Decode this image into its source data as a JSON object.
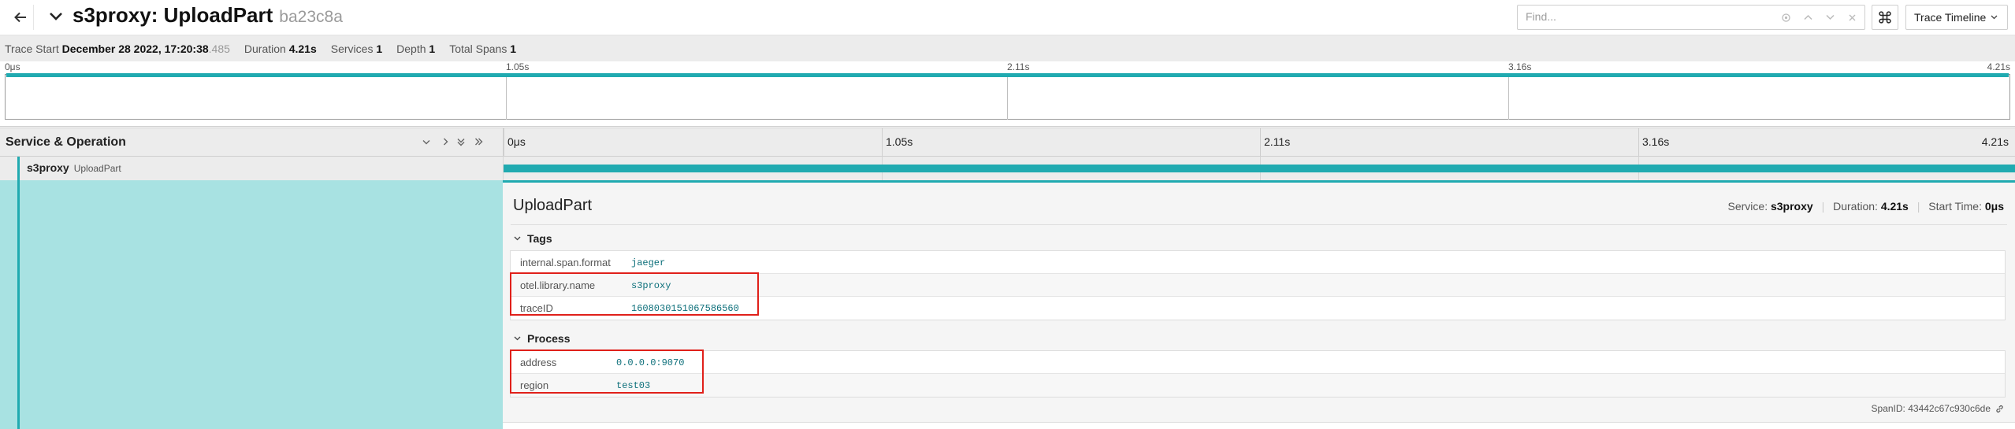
{
  "header": {
    "title": "s3proxy: UploadPart",
    "trace_id": "ba23c8a",
    "search_placeholder": "Find...",
    "view_label": "Trace Timeline"
  },
  "info": {
    "trace_start_label": "Trace Start",
    "trace_start_value": "December 28 2022, 17:20:38",
    "trace_start_ms": ".485",
    "duration_label": "Duration",
    "duration_value": "4.21s",
    "services_label": "Services",
    "services_value": "1",
    "depth_label": "Depth",
    "depth_value": "1",
    "total_spans_label": "Total Spans",
    "total_spans_value": "1"
  },
  "ticks": [
    "0μs",
    "1.05s",
    "2.11s",
    "3.16s",
    "4.21s"
  ],
  "timeline": {
    "column_title": "Service & Operation"
  },
  "span": {
    "service": "s3proxy",
    "operation": "UploadPart"
  },
  "detail": {
    "title": "UploadPart",
    "service_label": "Service:",
    "service_value": "s3proxy",
    "duration_label": "Duration:",
    "duration_value": "4.21s",
    "start_label": "Start Time:",
    "start_value": "0μs",
    "tags_title": "Tags",
    "tags": [
      {
        "key": "internal.span.format",
        "value": "jaeger"
      },
      {
        "key": "otel.library.name",
        "value": "s3proxy"
      },
      {
        "key": "traceID",
        "value": "1608030151067586560"
      }
    ],
    "process_title": "Process",
    "process": [
      {
        "key": "address",
        "value": "0.0.0.0:9070"
      },
      {
        "key": "region",
        "value": "test03"
      }
    ],
    "span_id_label": "SpanID:",
    "span_id_value": "43442c67c930c6de"
  },
  "colors": {
    "accent": "#20aab0",
    "detail_background": "#a8e2e2",
    "highlight": "#e0201a"
  },
  "icons": [
    "back-arrow-icon",
    "chevron-down-icon",
    "locate-icon",
    "chevron-up-icon",
    "close-icon",
    "command-key-icon",
    "chevron-right-icon",
    "double-chevron-down-icon",
    "double-chevron-right-icon",
    "link-icon"
  ]
}
